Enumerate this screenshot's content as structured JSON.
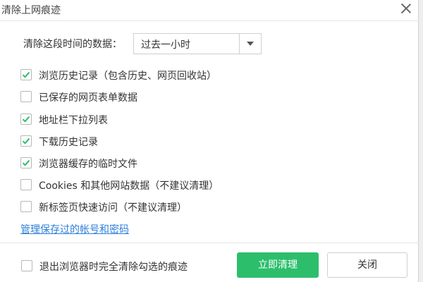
{
  "dialog": {
    "title": "清除上网痕迹",
    "close_icon": "close-icon"
  },
  "time_range": {
    "label": "清除这段时间的数据：",
    "selected": "过去一小时"
  },
  "options": [
    {
      "label": "浏览历史记录（包含历史、网页回收站）",
      "checked": true
    },
    {
      "label": "已保存的网页表单数据",
      "checked": false
    },
    {
      "label": "地址栏下拉列表",
      "checked": true
    },
    {
      "label": "下载历史记录",
      "checked": true
    },
    {
      "label": "浏览器缓存的临时文件",
      "checked": true
    },
    {
      "label": "Cookies 和其他网站数据（不建议清理）",
      "checked": false
    },
    {
      "label": "新标签页快速访问（不建议清理）",
      "checked": false
    }
  ],
  "manage_link": "管理保存过的帐号和密码",
  "footer": {
    "exit_clear_label": "退出浏览器时完全清除勾选的痕迹",
    "exit_clear_checked": false,
    "confirm_button": "立即清理",
    "cancel_button": "关闭"
  },
  "colors": {
    "accent_green": "#2dbe6c",
    "check_green": "#2dbe6c",
    "link_blue": "#2e7fd8"
  }
}
